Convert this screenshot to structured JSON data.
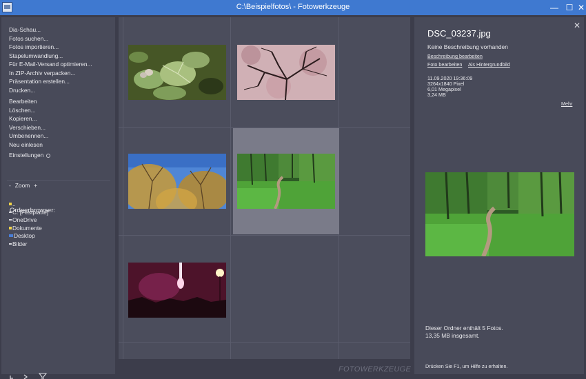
{
  "window": {
    "title": "C:\\Beispielfotos\\ - Fotowerkzeuge",
    "minimize_glyph": "—",
    "maximize_glyph": "☐",
    "close_glyph": "✕"
  },
  "sidebar": {
    "menu_group_1": [
      "Dia-Schau...",
      "Fotos suchen...",
      "Fotos importieren...",
      "Stapelumwandlung...",
      "Für E-Mail-Versand optimieren...",
      "In ZIP-Archiv verpacken...",
      "Präsentation erstellen...",
      "Drucken..."
    ],
    "menu_group_2": [
      "Bearbeiten",
      "Löschen...",
      "Kopieren...",
      "Verschieben...",
      "Umbenennen...",
      "Neu einlesen"
    ],
    "settings_label": "Einstellungen",
    "zoom": {
      "minus": "-",
      "label": "Zoom",
      "plus": "+"
    },
    "folder_browser": {
      "title": "Ordnerbrowser:",
      "items": [
        {
          "label": "..",
          "icon": "folder-up-icon"
        },
        {
          "label": "C: [Festplatte]",
          "icon": "drive-icon"
        },
        {
          "label": "OneDrive",
          "icon": "cloud-icon"
        },
        {
          "label": "Dokumente",
          "icon": "folder-icon"
        },
        {
          "label": "Desktop",
          "icon": "desktop-icon"
        },
        {
          "label": "Bilder",
          "icon": "pictures-icon"
        }
      ]
    },
    "bottom_icons": [
      "tree-icon",
      "console-icon",
      "filter-icon"
    ]
  },
  "grid": {
    "thumbnails": [
      {
        "name": "plant-leaves-photo",
        "kind": "leaves"
      },
      {
        "name": "blossom-tree-photo",
        "kind": "blossom"
      },
      {
        "name": "autumn-trees-photo",
        "kind": "autumn"
      },
      {
        "name": "forest-path-photo",
        "kind": "forest",
        "selected": true
      },
      {
        "name": "fireworks-photo",
        "kind": "fireworks"
      }
    ],
    "brand": "FOTOWERKZEUGE"
  },
  "details": {
    "close_glyph": "✕",
    "file_name": "DSC_03237.jpg",
    "description": "Keine Beschreibung vorhanden",
    "edit_description_link": "Beschreibung bearbeiten",
    "edit_photo_link": "Foto bearbeiten",
    "set_background_link": "Als Hintergrundbild",
    "datetime": "11.09.2020 19:36:09",
    "dimensions": "3264x1840 Pixel",
    "megapixel": "6,01 Megapixel",
    "file_size": "3,24 MB",
    "more_link": "Mehr",
    "folder_count": "Dieser Ordner enthält 5 Fotos.",
    "folder_size": "13,35 MB insgesamt.",
    "help": "Drücken Sie F1, um Hilfe zu erhalten."
  },
  "colors": {
    "titlebar": "#3f79d0",
    "background": "#3c3d4b",
    "panel": "#484a59",
    "grid": "#4b4d5c",
    "selected_cell": "#7a7b89"
  }
}
